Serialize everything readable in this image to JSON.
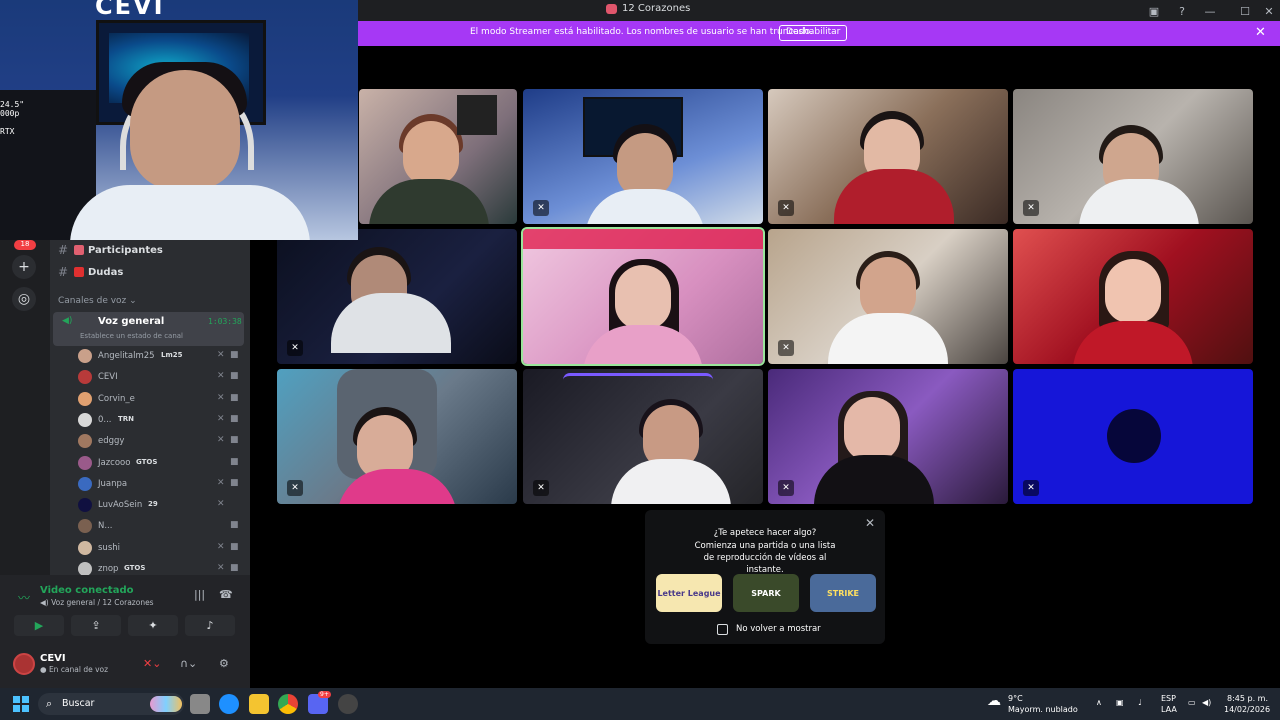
{
  "window": {
    "title": "12 Corazones"
  },
  "banner": {
    "message": "El modo Streamer está habilitado. Los nombres de usuario se han truncado.",
    "button_label": "Deshabilitar"
  },
  "streamer_cam": {
    "overlay_text": "24.5\"\n000p\n\nRTX"
  },
  "channels": {
    "text": [
      {
        "label": "Participantes"
      },
      {
        "label": "Dudas"
      }
    ],
    "category_label": "Canales de voz",
    "voice_channel": {
      "name": "Voz general",
      "duration": "1:03:38",
      "status_prompt": "Establece un estado de canal"
    },
    "users": [
      {
        "name": "Angelitalm25",
        "tag": "Lm25",
        "avatar_color": "#c9a08a",
        "mic_muted": true,
        "camera": true
      },
      {
        "name": "CEVI",
        "tag": "",
        "avatar_color": "#b83a3a",
        "mic_muted": true,
        "camera": true
      },
      {
        "name": "Corvin_e",
        "tag": "",
        "avatar_color": "#e0a070",
        "mic_muted": true,
        "camera": true
      },
      {
        "name": "0...",
        "tag": "TRN",
        "avatar_color": "#d8d8d8",
        "mic_muted": true,
        "camera": true
      },
      {
        "name": "edggy",
        "tag": "",
        "avatar_color": "#a07860",
        "mic_muted": true,
        "camera": true
      },
      {
        "name": "Jazcooo",
        "tag": "GTOS",
        "avatar_color": "#9a5a8a",
        "mic_muted": false,
        "camera": true
      },
      {
        "name": "Juanpa",
        "tag": "",
        "avatar_color": "#3a6ac0",
        "mic_muted": true,
        "camera": true
      },
      {
        "name": "LuvAoSein",
        "tag": "29",
        "avatar_color": "#101040",
        "mic_muted": true,
        "camera": false
      },
      {
        "name": "N...",
        "tag": "",
        "avatar_color": "#7a6050",
        "mic_muted": false,
        "camera": true
      },
      {
        "name": "sushi",
        "tag": "",
        "avatar_color": "#d0b8a0",
        "mic_muted": true,
        "camera": true
      },
      {
        "name": "znop",
        "tag": "GTOS",
        "avatar_color": "#c0c0c0",
        "mic_muted": true,
        "camera": true
      }
    ]
  },
  "voice_panel": {
    "title": "Video conectado",
    "subtitle_channel": "Voz general",
    "subtitle_server": "12 Corazones"
  },
  "user_panel": {
    "name": "CEVI",
    "status": "En canal de voz"
  },
  "popup": {
    "title": "¿Te apetece hacer algo?",
    "subtitle": "Comienza una partida o una lista de reproducción de vídeos al instante.",
    "activities": [
      {
        "label": "Letter League",
        "bg": "#f6e7b0",
        "fg": "#4a3a8a"
      },
      {
        "label": "SPARK",
        "bg": "#3a4a2a",
        "fg": "#ffffff"
      },
      {
        "label": "STRIKE",
        "bg": "#4a6a9a",
        "fg": "#ffe060"
      }
    ],
    "checkbox_label": "No volver a mostrar"
  },
  "guild_badge": "18",
  "taskbar": {
    "search_placeholder": "Buscar",
    "weather_temp": "9°C",
    "weather_desc": "Mayorm. nublado",
    "lang": "ESP",
    "layout": "LAA",
    "time": "8:45 p. m.",
    "date": "14/02/2026",
    "discord_badge": "9+"
  },
  "colors": {
    "accent_purple": "#a638f5",
    "online_green": "#23a55a",
    "speaking_outline": "#9be59b"
  }
}
